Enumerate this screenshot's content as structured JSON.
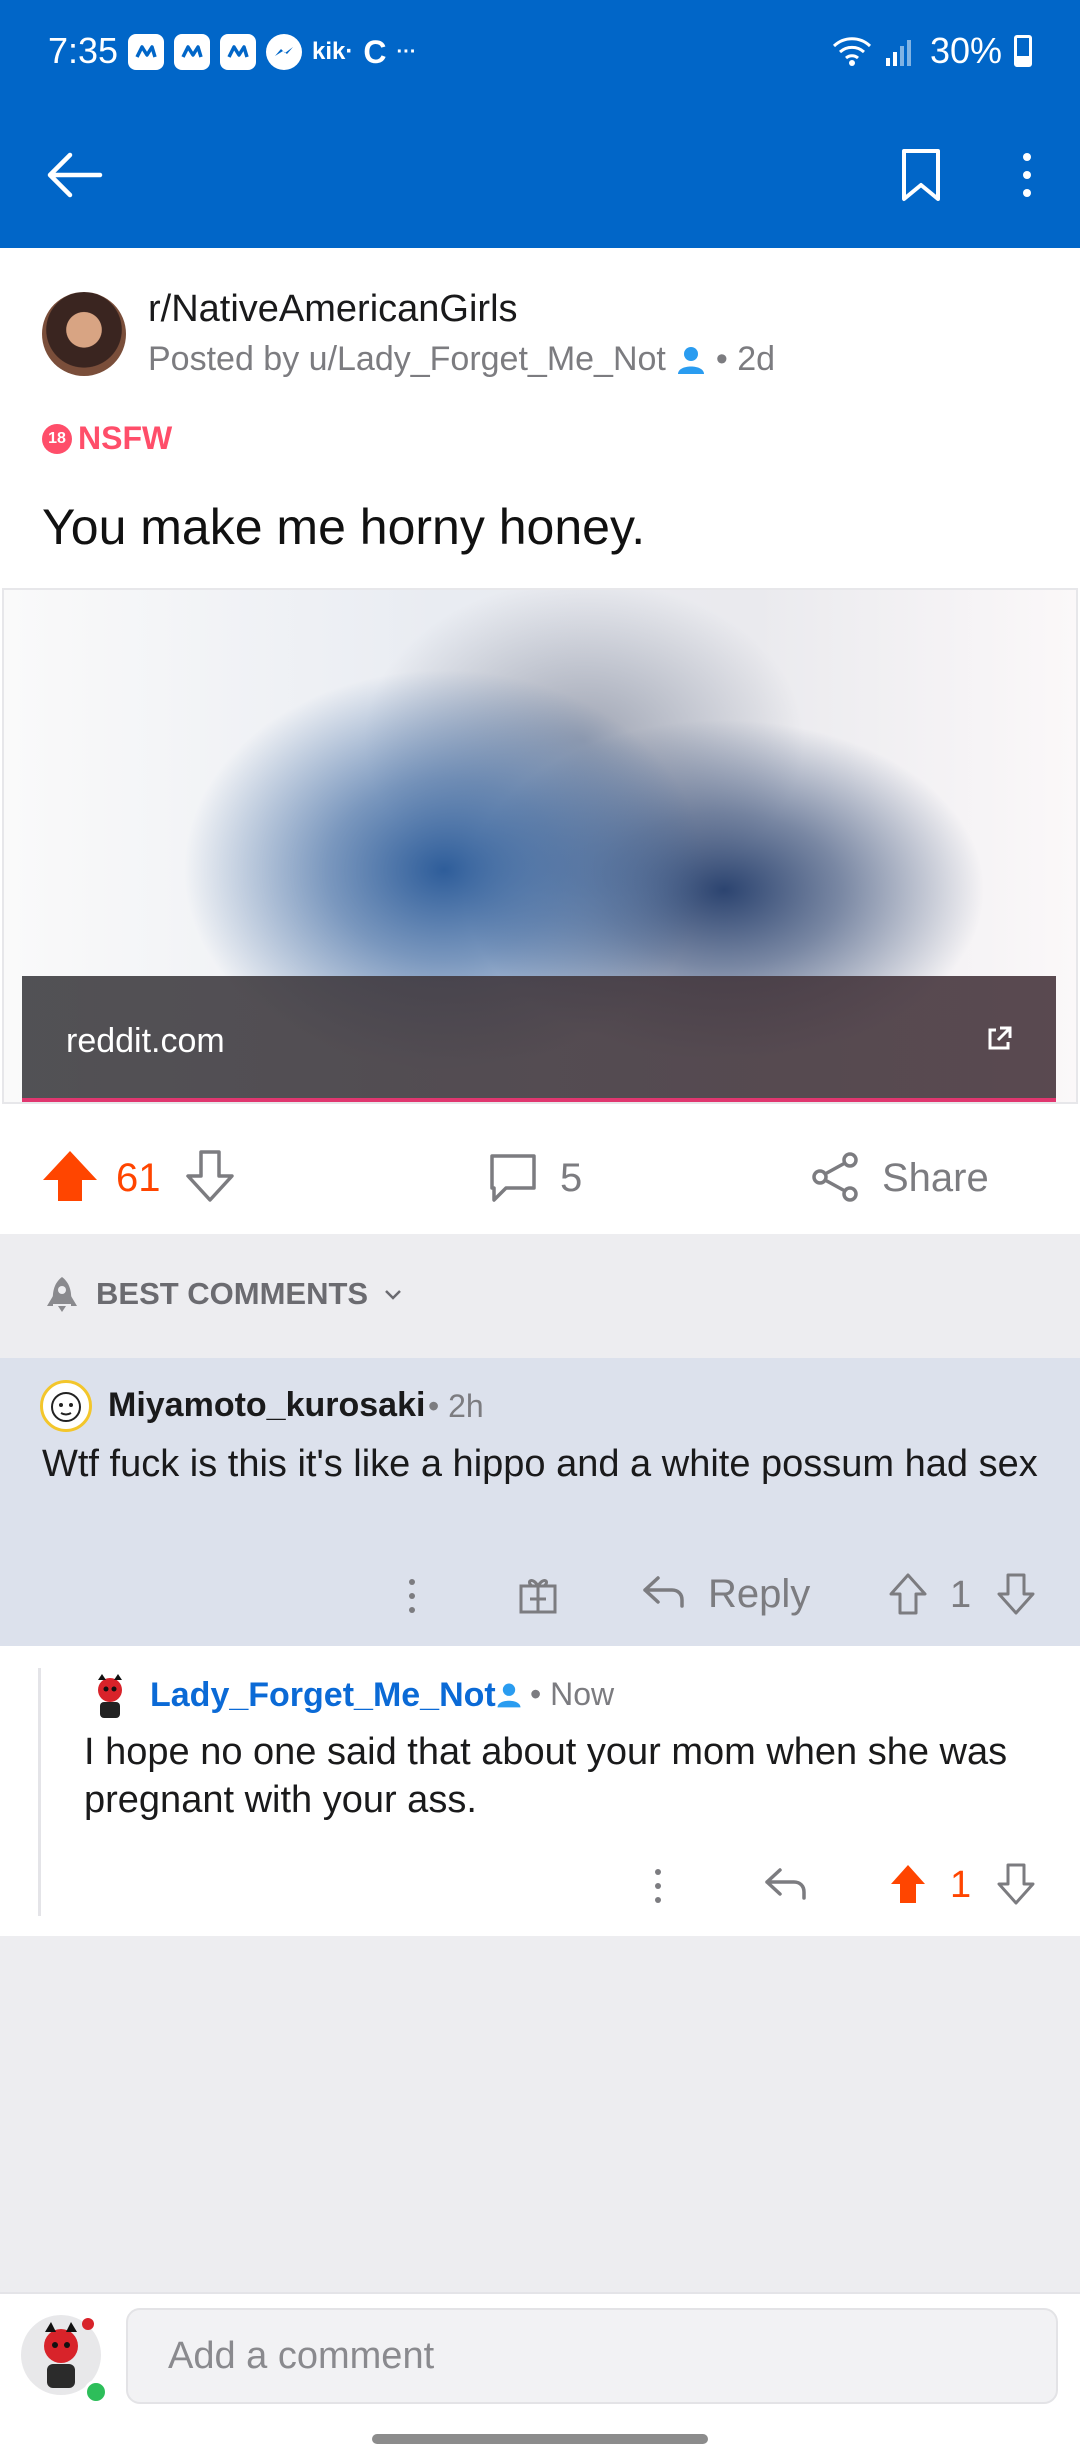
{
  "status_bar": {
    "time": "7:35",
    "kik_label": "kik·",
    "c_label": "C",
    "more_dots": "···",
    "battery": "30%"
  },
  "post": {
    "subreddit": "r/NativeAmericanGirls",
    "posted_by_prefix": "Posted by u/Lady_Forget_Me_Not",
    "age": "• 2d",
    "nsfw_badge_number": "18",
    "nsfw_label": "NSFW",
    "title": "You make me horny honey.",
    "link_domain": "reddit.com",
    "score": "61",
    "comment_count": "5",
    "share_label": "Share"
  },
  "sort": {
    "label": "BEST COMMENTS"
  },
  "comments": [
    {
      "author": "Miyamoto_kurosaki",
      "time": "• 2h",
      "body": "Wtf fuck is this  it's like a hippo and a white possum had sex",
      "reply_label": "Reply",
      "score": "1"
    },
    {
      "author": "Lady_Forget_Me_Not",
      "time": "• Now",
      "body": "I hope no one said that about your mom when she was pregnant with your ass.",
      "score": "1"
    }
  ],
  "composer": {
    "placeholder": "Add a comment"
  },
  "colors": {
    "app_bar": "#0166c8",
    "upvote_active": "#ff4500",
    "nsfw": "#ff4e6a",
    "op_name": "#0b6ad6"
  },
  "icons": [
    "back-arrow-icon",
    "bookmark-icon",
    "more-vertical-icon",
    "person-icon",
    "external-link-icon",
    "upvote-icon",
    "downvote-icon",
    "comment-icon",
    "share-icon",
    "rocket-icon",
    "chevron-down-icon",
    "award-icon",
    "reply-icon"
  ]
}
